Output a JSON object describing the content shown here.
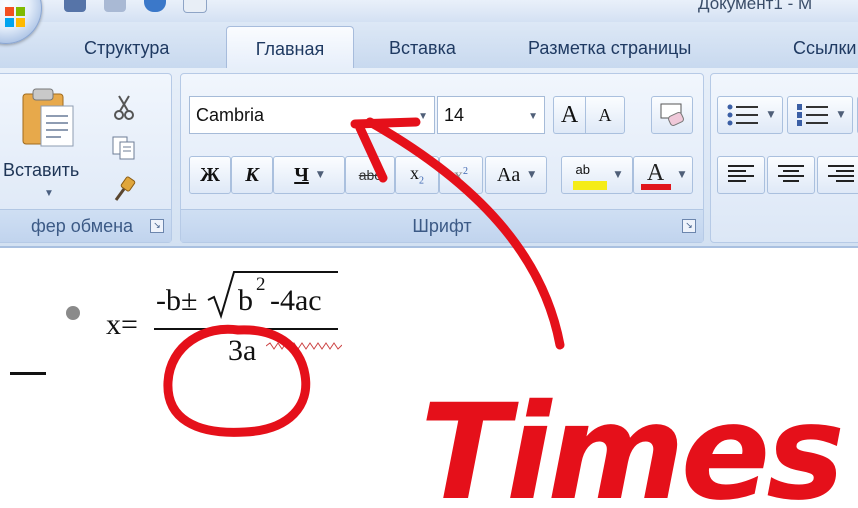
{
  "title_bar": {
    "document_title": "Документ1 - M"
  },
  "quick_access": {
    "buttons": [
      "save-icon",
      "undo-icon",
      "redo-icon",
      "print-preview-icon"
    ]
  },
  "tabs": [
    {
      "label": "Структура"
    },
    {
      "label": "Главная",
      "active": true
    },
    {
      "label": "Вставка"
    },
    {
      "label": "Разметка страницы"
    },
    {
      "label": "Ссылки"
    }
  ],
  "clipboard": {
    "paste_label": "Вставить",
    "group_label": "фер обмена"
  },
  "font": {
    "font_name": "Cambria",
    "font_size": "14",
    "group_label": "Шрифт",
    "bold": "Ж",
    "italic": "К",
    "underline": "Ч",
    "strike": "abc",
    "subscript": "x",
    "superscript": "x",
    "change_case": "Aa",
    "grow": "A",
    "shrink": "A",
    "font_color_letter": "A",
    "highlight_text": "ab"
  },
  "formula": {
    "lhs": "x=",
    "numerator_minus_b": "-b±",
    "radicand_b": "b",
    "exponent": "2",
    "minus_4ac": "-4ac",
    "denominator": "3a"
  },
  "annotation": {
    "handwritten_text": "Times",
    "color": "#e5101a"
  },
  "colors": {
    "ribbon_bg": "#dce7f6",
    "tab_text": "#1f3a62",
    "group_label": "#3c5a86",
    "highlight_yellow": "#f5ec18",
    "font_color_red": "#e0151b"
  }
}
